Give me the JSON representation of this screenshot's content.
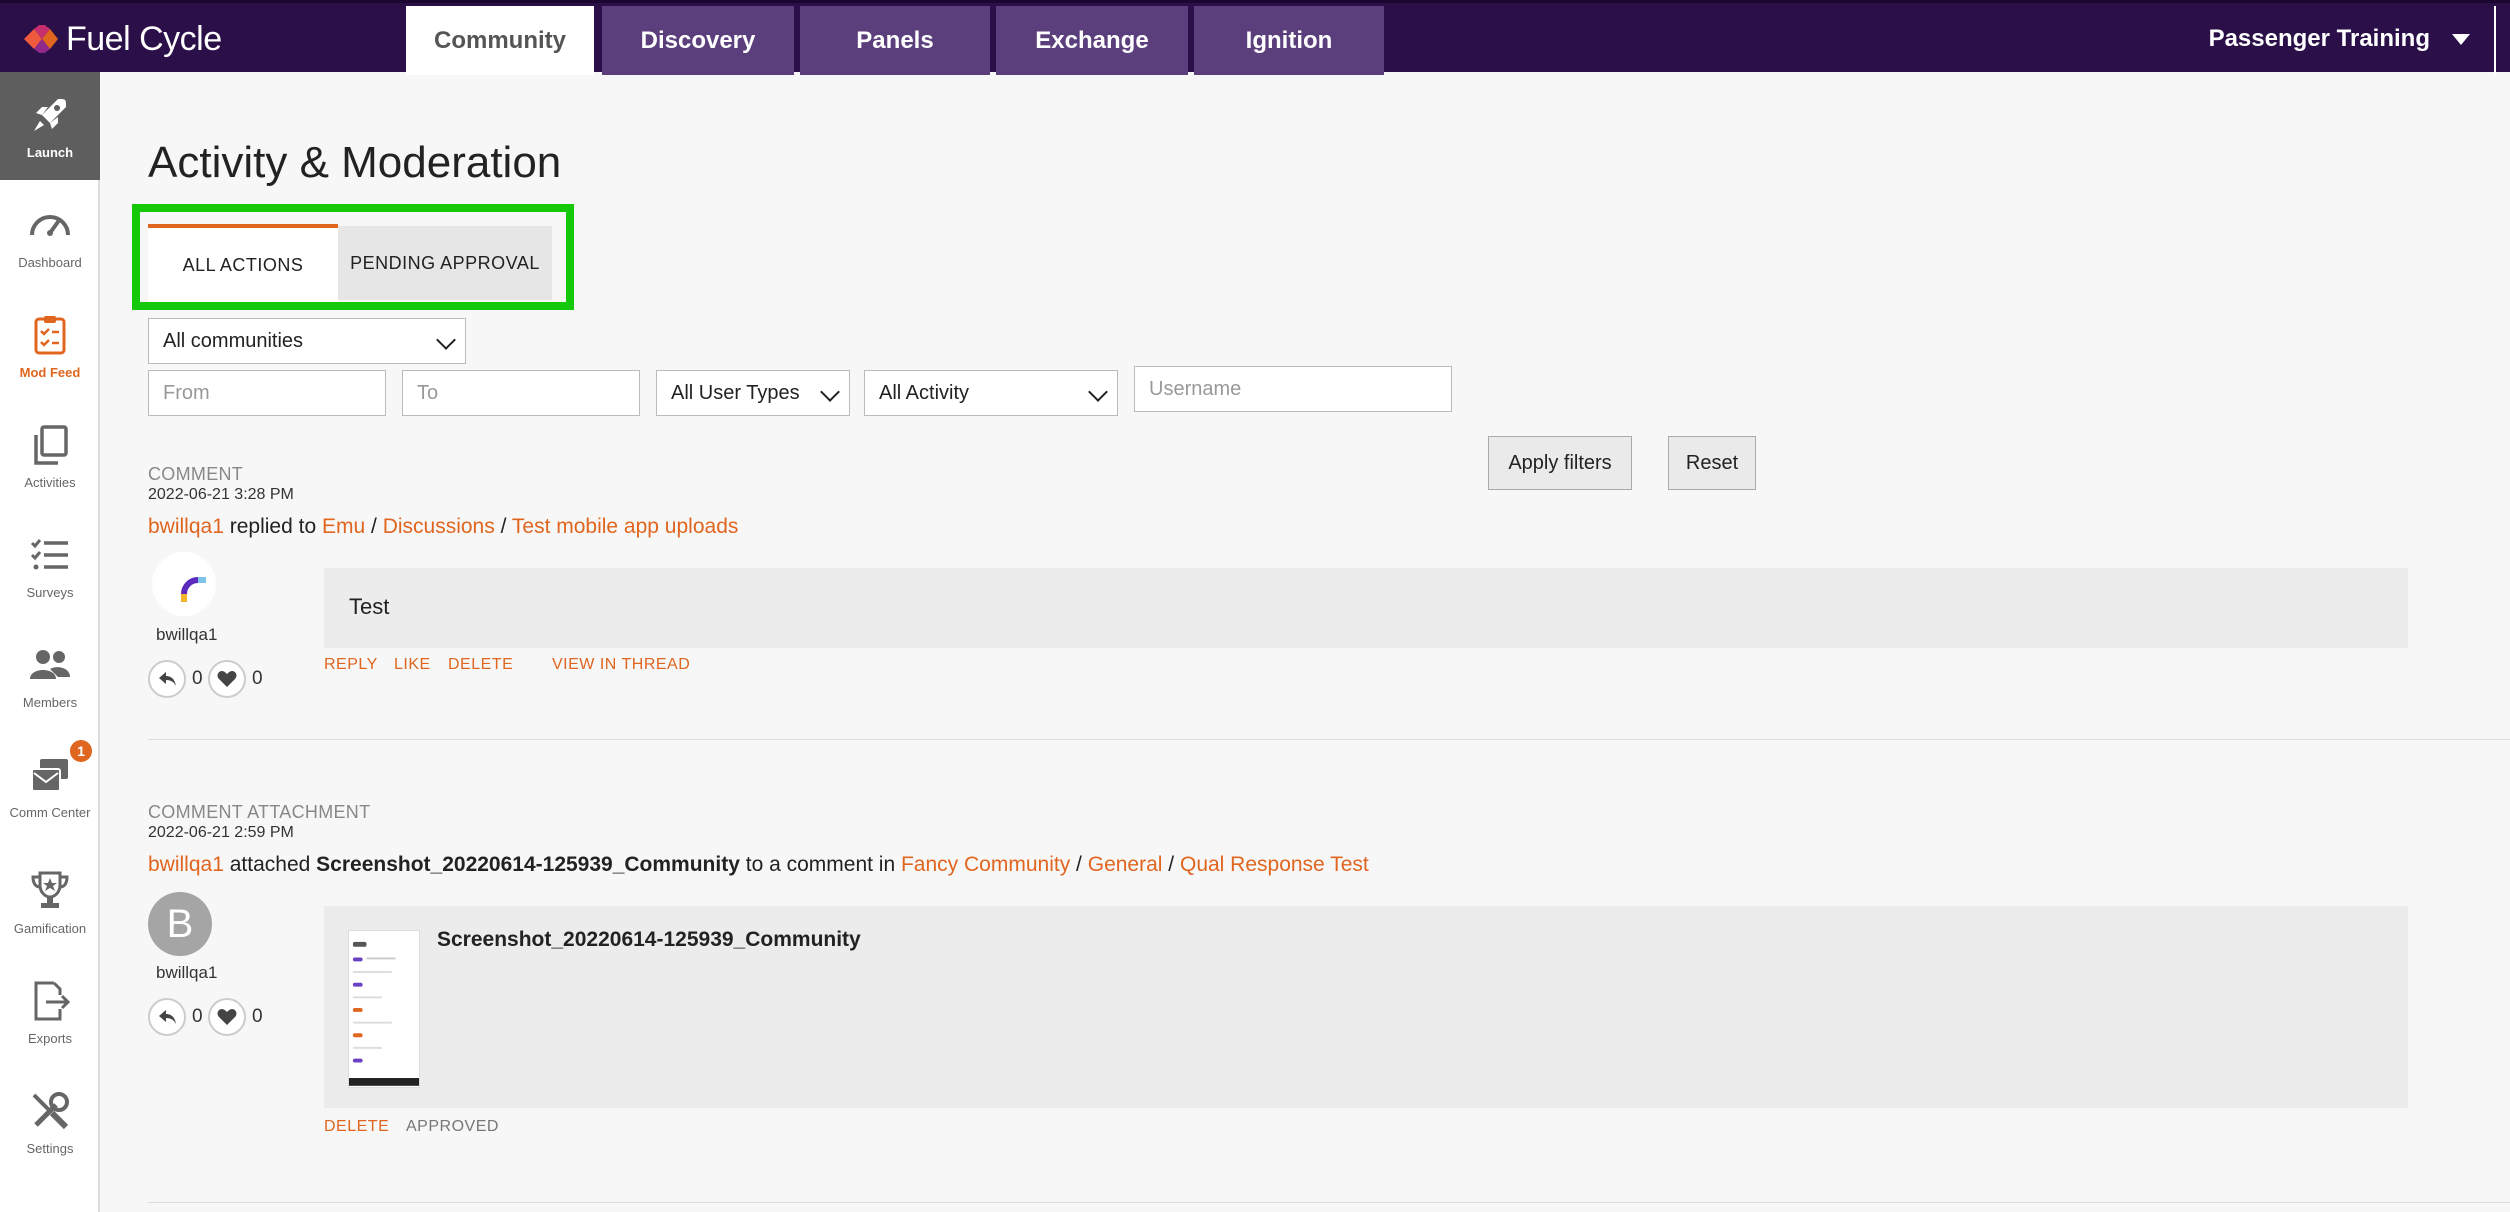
{
  "brand": {
    "name": "Fuel Cycle",
    "accent": "#e0651f",
    "nav_bg": "#2a0f48",
    "highlight": "#16c80a"
  },
  "nav": {
    "tabs": [
      {
        "label": "Community",
        "active": true
      },
      {
        "label": "Discovery",
        "active": false
      },
      {
        "label": "Panels",
        "active": false
      },
      {
        "label": "Exchange",
        "active": false
      },
      {
        "label": "Ignition",
        "active": false
      }
    ],
    "account": "Passenger Training"
  },
  "sidebar": {
    "items": [
      {
        "label": "Launch",
        "icon": "rocket-icon",
        "active": true
      },
      {
        "label": "Dashboard",
        "icon": "gauge-icon"
      },
      {
        "label": "Mod Feed",
        "icon": "clipboard-icon",
        "highlight": true
      },
      {
        "label": "Activities",
        "icon": "copy-icon"
      },
      {
        "label": "Surveys",
        "icon": "checklist-icon"
      },
      {
        "label": "Members",
        "icon": "users-icon"
      },
      {
        "label": "Comm Center",
        "icon": "mail-icon",
        "badge": "1"
      },
      {
        "label": "Gamification",
        "icon": "trophy-icon"
      },
      {
        "label": "Exports",
        "icon": "export-icon"
      },
      {
        "label": "Settings",
        "icon": "tools-icon"
      }
    ]
  },
  "page": {
    "title": "Activity & Moderation",
    "tabs": {
      "all": "ALL ACTIONS",
      "pending": "PENDING APPROVAL"
    }
  },
  "filters": {
    "community": "All communities",
    "from_placeholder": "From",
    "to_placeholder": "To",
    "user_types": "All User Types",
    "activity": "All Activity",
    "username_placeholder": "Username",
    "apply": "Apply filters",
    "reset": "Reset"
  },
  "entries": [
    {
      "type": "COMMENT",
      "date": "2022-06-21 3:28 PM",
      "user": "bwillqa1",
      "verb": "replied to",
      "path": [
        "Emu",
        "Discussions",
        "Test mobile app uploads"
      ],
      "sep": "/",
      "body": "Test",
      "replies": "0",
      "likes": "0",
      "actions": {
        "reply": "REPLY",
        "like": "LIKE",
        "delete": "DELETE",
        "view": "VIEW IN THREAD"
      }
    },
    {
      "type": "COMMENT ATTACHMENT",
      "date": "2022-06-21 2:59 PM",
      "user": "bwillqa1",
      "avatar_letter": "B",
      "verb": "attached",
      "file": "Screenshot_20220614-125939_Community",
      "middle": "to a comment in",
      "path": [
        "Fancy Community",
        "General",
        "Qual Response Test"
      ],
      "sep": "/",
      "attachment_title": "Screenshot_20220614-125939_Community",
      "replies": "0",
      "likes": "0",
      "actions": {
        "delete": "DELETE",
        "status": "APPROVED"
      }
    }
  ]
}
